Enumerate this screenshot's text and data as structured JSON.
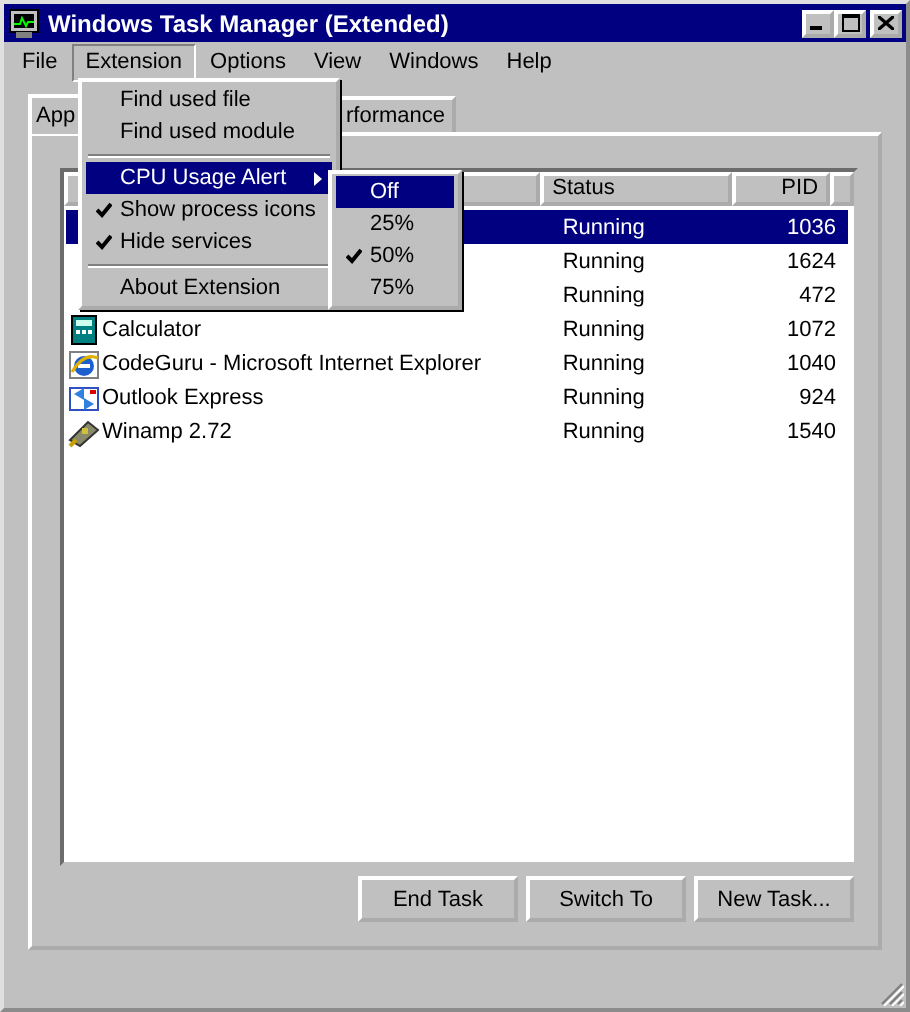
{
  "window": {
    "title": "Windows Task Manager (Extended)"
  },
  "menu_bar": [
    {
      "label": "File",
      "selected": false
    },
    {
      "label": "Extension",
      "selected": true
    },
    {
      "label": "Options",
      "selected": false
    },
    {
      "label": "View",
      "selected": false
    },
    {
      "label": "Windows",
      "selected": false
    },
    {
      "label": "Help",
      "selected": false
    }
  ],
  "extension_menu": [
    {
      "kind": "command",
      "label": "Find used file"
    },
    {
      "kind": "command",
      "label": "Find used module"
    },
    {
      "kind": "separator"
    },
    {
      "kind": "submenu",
      "label": "CPU Usage Alert",
      "selected": true
    },
    {
      "kind": "check",
      "label": "Show process icons",
      "checked": true
    },
    {
      "kind": "check",
      "label": "Hide services",
      "checked": true
    },
    {
      "kind": "separator"
    },
    {
      "kind": "command",
      "label": "About Extension"
    }
  ],
  "cpu_alert_submenu": [
    {
      "label": "Off",
      "selected": true,
      "checked": false
    },
    {
      "label": "25%",
      "selected": false,
      "checked": false
    },
    {
      "label": "50%",
      "selected": false,
      "checked": true
    },
    {
      "label": "75%",
      "selected": false,
      "checked": false
    }
  ],
  "tabs": [
    {
      "label": "App",
      "selected": true
    },
    {
      "label": "rformance",
      "selected": false
    }
  ],
  "table": {
    "columns": [
      "Status",
      "PID"
    ],
    "rows": [
      {
        "status": "Running",
        "pid": "1036",
        "selected": true
      },
      {
        "status": "Running",
        "pid": "1624",
        "selected": false
      },
      {
        "status": "Running",
        "pid": "472",
        "selected": false
      },
      {
        "name": "Calculator",
        "status": "Running",
        "pid": "1072",
        "selected": false
      },
      {
        "name": "CodeGuru - Microsoft Internet Explorer",
        "status": "Running",
        "pid": "1040",
        "selected": false
      },
      {
        "name": "Outlook Express",
        "status": "Running",
        "pid": "924",
        "selected": false
      },
      {
        "name": "Winamp 2.72",
        "status": "Running",
        "pid": "1540",
        "selected": false
      }
    ]
  },
  "buttons": [
    "End Task",
    "Switch To",
    "New Task..."
  ]
}
